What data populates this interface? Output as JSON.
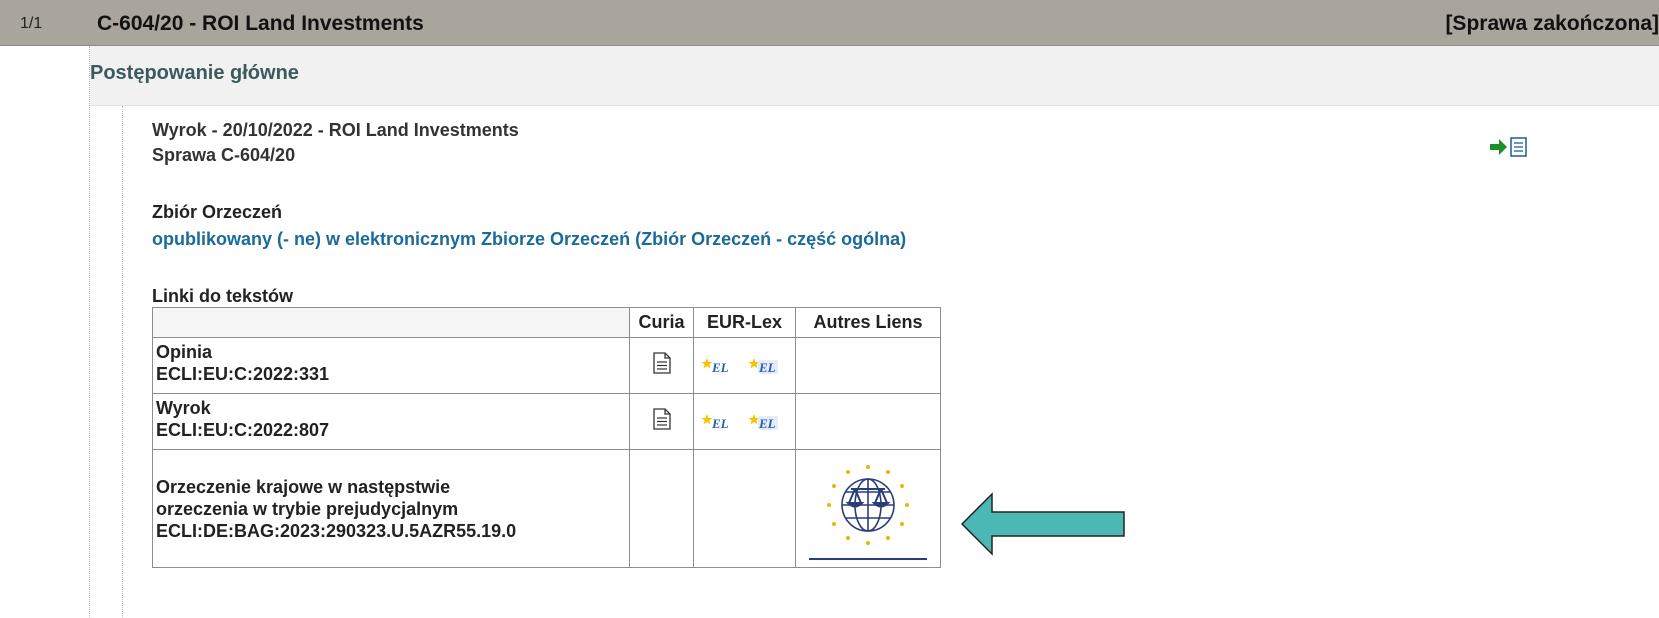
{
  "header": {
    "counter": "1/1",
    "case_title": "C-604/20 - ROI Land Investments",
    "status": "[Sprawa zakończona]"
  },
  "section": {
    "title": "Postępowanie główne"
  },
  "judgment": {
    "line1": "Wyrok - 20/10/2022 - ROI Land Investments",
    "line2": "Sprawa C-604/20",
    "doc_link_icon": "arrow-document-icon"
  },
  "reports": {
    "heading": "Zbiór Orzeczeń",
    "link": "opublikowany (- ne) w elektronicznym Zbiorze Orzeczeń (Zbiór Orzeczeń - część ogólna)"
  },
  "links": {
    "heading": "Linki do tekstów",
    "columns": [
      "",
      "Curia",
      "EUR-Lex",
      "Autres Liens"
    ],
    "rows": [
      {
        "title": "Opinia",
        "ecli": "ECLI:EU:C:2022:331",
        "curia_icon": "document-icon",
        "eurlex_icons": [
          "eurlex-icon",
          "eurlex-icon"
        ]
      },
      {
        "title": "Wyrok",
        "ecli": "ECLI:EU:C:2022:807",
        "curia_icon": "document-icon",
        "eurlex_icons": [
          "eurlex-icon",
          "eurlex-icon"
        ]
      },
      {
        "title_line1": "Orzeczenie krajowe w następstwie",
        "title_line2": "orzeczenia w trybie prejudycjalnym",
        "ecli": "ECLI:DE:BAG:2023:290323.U.5AZR55.19.0",
        "autres_icon": "ecj-globe-icon"
      }
    ]
  },
  "colors": {
    "header_bg": "#a9a49c",
    "section_bg": "#f1f1f1",
    "link_blue": "#1a6a9b",
    "arrow_fill": "#4cb8b6",
    "doc_arrow_green": "#1a8f2a"
  }
}
